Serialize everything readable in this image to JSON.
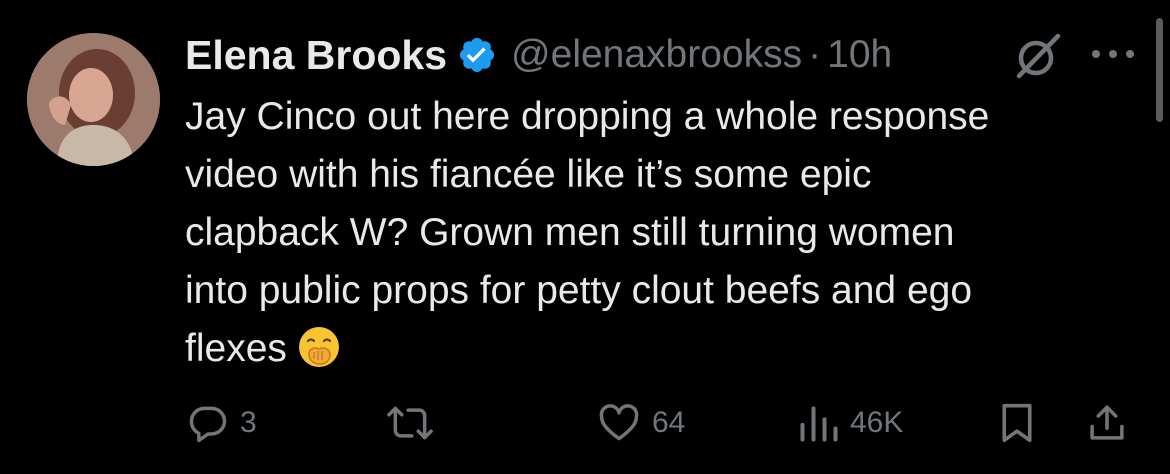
{
  "tweet": {
    "author_name": "Elena Brooks",
    "handle": "@elenaxbrookss",
    "separator": "·",
    "time": "10h",
    "text": "Jay Cinco out here dropping a whole response\nvideo with his fiancée like it’s some epic\nclapback W? Grown men still turning women\ninto public props for petty clout beefs and ego\nflexes",
    "emoji": "face-with-hand-over-mouth"
  },
  "actions": {
    "replies": "3",
    "likes": "64",
    "views": "46K"
  },
  "colors": {
    "background": "#000000",
    "text": "#e7e9ea",
    "muted": "#71767b",
    "verified": "#1d9bf0"
  }
}
